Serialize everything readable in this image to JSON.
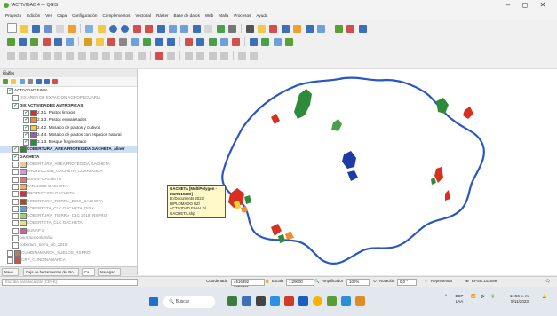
{
  "window": {
    "title": "*ACTIVIDAD 4 — QGIS",
    "controls": {
      "minimize": "–",
      "maximize": "◻",
      "close": "✕"
    }
  },
  "menu": [
    "Proyecto",
    "Edición",
    "Ver",
    "Capa",
    "Configuración",
    "Complementos",
    "Vectorial",
    "Ráster",
    "Base de datos",
    "Web",
    "Malla",
    "Procesos",
    "Ayuda"
  ],
  "layers_panel": {
    "title": "Capas",
    "buttons": "⊡ ✕",
    "items": [
      {
        "label": "ACTIVIDAD FINAL",
        "checked": true,
        "style": "normal",
        "indent": 8,
        "swatch": ""
      },
      {
        "label": "DIX AREA DE EXPACIÓN AGROPECUARIA",
        "checked": false,
        "style": "grey",
        "indent": 14,
        "swatch": ""
      },
      {
        "label": "DIX ACTIVIDADES ANTROPICAS",
        "checked": true,
        "style": "bold",
        "indent": 14,
        "swatch": ""
      },
      {
        "label": "2.3.1. Pastos limpios",
        "checked": true,
        "style": "normal",
        "indent": 26,
        "swatch": "#d7301f"
      },
      {
        "label": "2.3.3. Pastos enmalezados",
        "checked": true,
        "style": "normal",
        "indent": 26,
        "swatch": "#f08c2c"
      },
      {
        "label": "2.4.2. Mosaico de pastos y cultivos",
        "checked": true,
        "style": "normal",
        "indent": 26,
        "swatch": "#f0d030"
      },
      {
        "label": "2.4.4. Mosaico de pastos con espacios natural",
        "checked": true,
        "style": "normal",
        "indent": 26,
        "swatch": "#9b59b6"
      },
      {
        "label": "3.1.3. Bosque fragmentado",
        "checked": true,
        "style": "normal",
        "indent": 26,
        "swatch": "#2e8b3a"
      },
      {
        "label": "COBERTURA_AREAPROTEGIDA GACHETA_aliner",
        "checked": true,
        "style": "bold",
        "indent": 14,
        "swatch": "#3b7d3b"
      },
      {
        "label": "GACHETA",
        "checked": true,
        "style": "bold",
        "indent": 14,
        "swatch": ""
      },
      {
        "label": "COBERTURA_AREAPROTEGIDA GACHETA",
        "checked": false,
        "style": "grey",
        "indent": 14,
        "swatch": "#e8c8a0"
      },
      {
        "label": "PROTECCIÓN_GACHETA_CORREGIDA",
        "checked": false,
        "style": "grey",
        "indent": 14,
        "swatch": "#c8a0e0"
      },
      {
        "label": "BUNAP GACHETA",
        "checked": false,
        "style": "grey",
        "indent": 14,
        "swatch": "#e07a7a"
      },
      {
        "label": "PARAMOS GACHETA",
        "checked": false,
        "style": "grey",
        "indent": 14,
        "swatch": "#f0b060"
      },
      {
        "label": "PROTECCION GACHETA",
        "checked": false,
        "style": "grey",
        "indent": 14,
        "swatch": "#cc3344"
      },
      {
        "label": "COBERTURA_TIERRA_DIXX_GACHETA",
        "checked": false,
        "style": "grey",
        "indent": 14,
        "swatch": "#a0522d"
      },
      {
        "label": "COBERTETA_CLC GACHETA_DIXX",
        "checked": false,
        "style": "grey",
        "indent": 14,
        "swatch": "#66a0d0"
      },
      {
        "label": "COBERTURA_TIERRA_CLC 2018_RSPRO",
        "checked": false,
        "style": "grey",
        "indent": 14,
        "swatch": "#a0d070"
      },
      {
        "label": "COBERTETA_CLC GACHETA",
        "checked": false,
        "style": "grey",
        "indent": 14,
        "swatch": "#e0e080"
      },
      {
        "label": "BUNAP 2",
        "checked": false,
        "style": "grey",
        "indent": 14,
        "swatch": "#d06090"
      },
      {
        "label": "paramos colombia",
        "checked": false,
        "style": "grey-italic",
        "indent": 14,
        "swatch": ""
      },
      {
        "label": "cobertura_tierra_clc_2018",
        "checked": false,
        "style": "grey-italic",
        "indent": 14,
        "swatch": ""
      },
      {
        "label": "CUNDINAMARCA_SUELOS_RSPRO",
        "checked": false,
        "style": "grey",
        "indent": 8,
        "swatch": "#b08060"
      },
      {
        "label": "CRP_CUNDINAMARCA",
        "checked": false,
        "style": "grey",
        "indent": 8,
        "swatch": "#d05050"
      }
    ],
    "tabs": [
      "Nave...",
      "Caja de herramientas de Pro...",
      "Ca...",
      "Navegad..."
    ]
  },
  "map": {
    "tooltip_lines": [
      "GACHETA [MultiPolygon - EGRU10200]",
      "D:/Documents 2023/",
      "DIPLOMADO UZ/",
      "ACTIVIDAD FINAL 6/",
      "GACHETA.shp"
    ]
  },
  "status_bar": {
    "search_placeholder": "Escriba para localizar (Ctrl+K)",
    "coordinate_label": "Coordenada",
    "coordinate_value": "4516392 2099401",
    "scale_label": "Escala",
    "scale_value": "1:29000",
    "magnifier_label": "Amplificador",
    "magnifier_value": "100%",
    "rotation_label": "Rotación",
    "rotation_value": "0,0 °",
    "render_label": "Representar",
    "crs": "EPSG:102089"
  },
  "taskbar": {
    "search": "Buscar",
    "lang": "ESP LAA",
    "time": "11:56 p. m.",
    "date": "5/11/2023"
  }
}
